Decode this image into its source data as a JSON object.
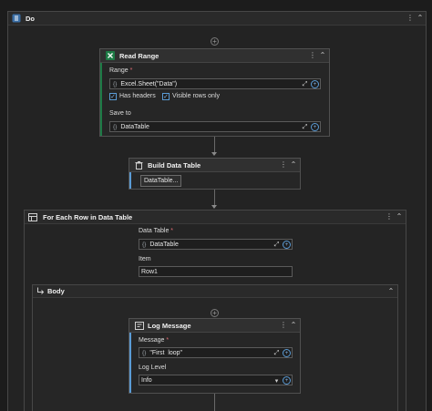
{
  "do_block": {
    "title": "Do"
  },
  "read_range": {
    "title": "Read Range",
    "range_label": "Range",
    "required_mark": "*",
    "range_value": "Excel.Sheet(\"Data\")",
    "has_headers_label": "Has headers",
    "has_headers_checked": true,
    "visible_rows_label": "Visible rows only",
    "visible_rows_checked": true,
    "save_to_label": "Save to",
    "save_to_value": "DataTable"
  },
  "build_data_table": {
    "title": "Build Data Table",
    "button_label": "DataTable..."
  },
  "for_each": {
    "title": "For Each Row in Data Table",
    "data_table_label": "Data Table",
    "required_mark": "*",
    "data_table_value": "DataTable",
    "item_label": "Item",
    "item_value": "Row1",
    "body_title": "Body"
  },
  "log_message": {
    "title": "Log Message",
    "message_label": "Message",
    "required_mark": "*",
    "message_value": "\"First  loop\"",
    "log_level_label": "Log Level",
    "log_level_value": "Info"
  },
  "icons": {
    "expression": "{}",
    "expand_expression": "⤢",
    "more": "⋮",
    "collapse": "⌃",
    "plus": "+",
    "check": "✓",
    "dropdown": "▾"
  },
  "colors": {
    "excel_green": "#1d7a45",
    "accent_blue": "#5a9bd5",
    "background": "#1c1c1c"
  }
}
